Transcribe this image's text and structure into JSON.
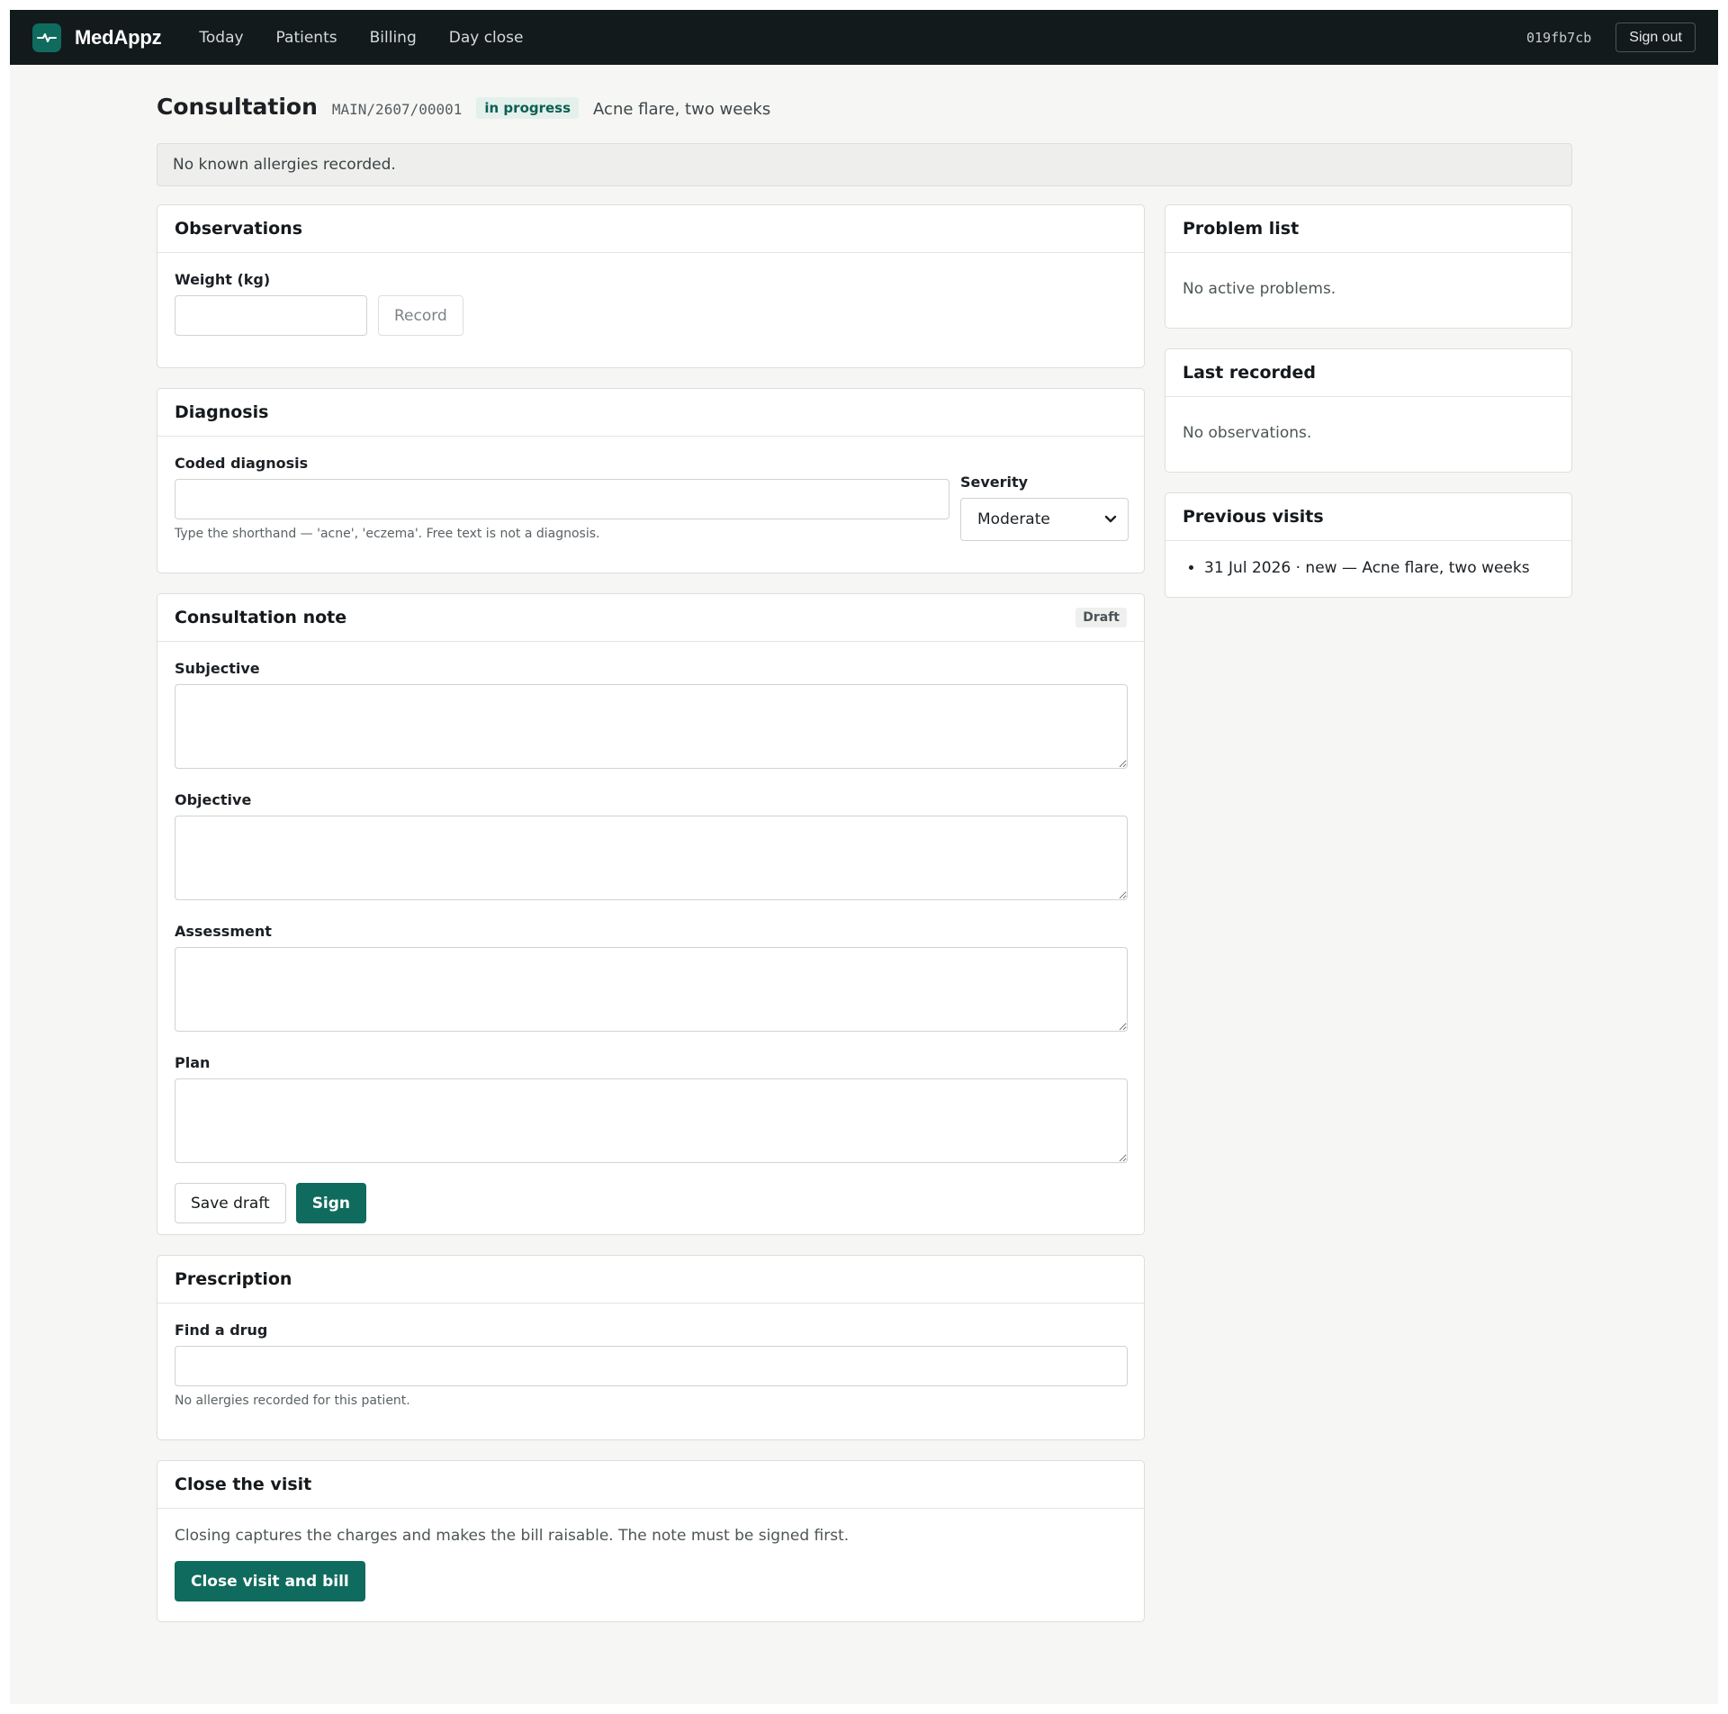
{
  "app": {
    "brand": "MedAppz",
    "nav": [
      "Today",
      "Patients",
      "Billing",
      "Day close"
    ],
    "session_id": "019fb7cb",
    "sign_out_label": "Sign out"
  },
  "header": {
    "title": "Consultation",
    "visit_code": "MAIN/2607/00001",
    "status": "in progress",
    "reason": "Acne flare, two weeks"
  },
  "allergy_banner": "No known allergies recorded.",
  "observations": {
    "title": "Observations",
    "weight_label": "Weight (kg)",
    "weight_value": "",
    "record_label": "Record"
  },
  "diagnosis": {
    "title": "Diagnosis",
    "coded_label": "Coded diagnosis",
    "coded_value": "",
    "hint": "Type the shorthand — 'acne', 'eczema'. Free text is not a diagnosis.",
    "severity_label": "Severity",
    "severity_value": "Moderate"
  },
  "note": {
    "title": "Consultation note",
    "badge": "Draft",
    "fields": [
      {
        "label": "Subjective",
        "value": ""
      },
      {
        "label": "Objective",
        "value": ""
      },
      {
        "label": "Assessment",
        "value": ""
      },
      {
        "label": "Plan",
        "value": ""
      }
    ],
    "save_label": "Save draft",
    "sign_label": "Sign"
  },
  "prescription": {
    "title": "Prescription",
    "drug_label": "Find a drug",
    "drug_value": "",
    "hint": "No allergies recorded for this patient."
  },
  "close_visit": {
    "title": "Close the visit",
    "description": "Closing captures the charges and makes the bill raisable. The note must be signed first.",
    "button_label": "Close visit and bill"
  },
  "sidebar": {
    "problem_list": {
      "title": "Problem list",
      "empty": "No active problems."
    },
    "last_recorded": {
      "title": "Last recorded",
      "empty": "No observations."
    },
    "previous_visits": {
      "title": "Previous visits",
      "items": [
        "31 Jul 2026 · new — Acne flare, two weeks"
      ]
    }
  },
  "colors": {
    "accent": "#0f6b5d",
    "topbar": "#121a1c",
    "page_background": "#f6f6f4"
  },
  "icons": {
    "logo": "pulse-icon",
    "select": "chevron-down-icon"
  }
}
